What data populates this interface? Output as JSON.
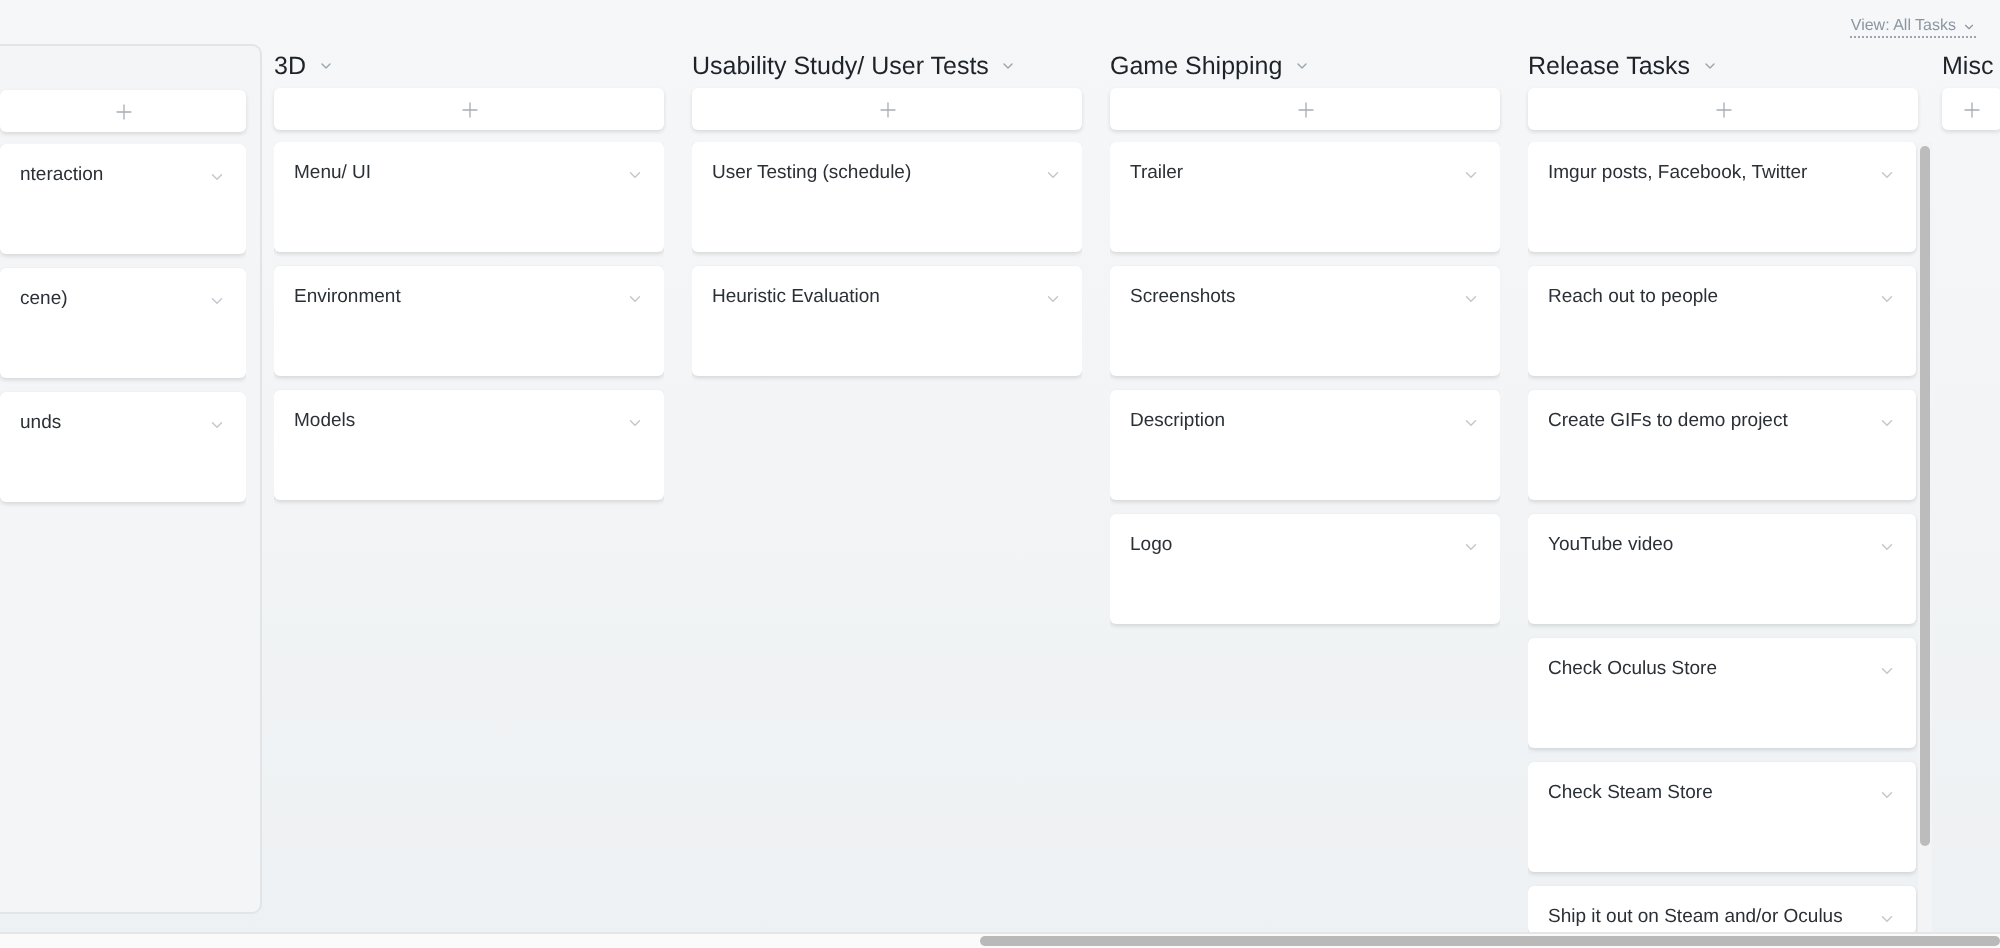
{
  "view_menu": {
    "label": "View: All Tasks"
  },
  "columns": [
    {
      "kind": "partial",
      "cards": [
        {
          "title": "nteraction"
        },
        {
          "title": "cene)"
        },
        {
          "title": "unds"
        }
      ]
    },
    {
      "kind": "full",
      "title": "3D",
      "cards": [
        {
          "title": "Menu/ UI"
        },
        {
          "title": "Environment"
        },
        {
          "title": "Models"
        }
      ]
    },
    {
      "kind": "full",
      "title": "Usability Study/ User Tests",
      "cards": [
        {
          "title": "User Testing (schedule)"
        },
        {
          "title": "Heuristic Evaluation"
        }
      ]
    },
    {
      "kind": "full",
      "title": "Game Shipping",
      "cards": [
        {
          "title": "Trailer"
        },
        {
          "title": "Screenshots"
        },
        {
          "title": "Description"
        },
        {
          "title": "Logo"
        }
      ]
    },
    {
      "kind": "scrolling",
      "title": "Release Tasks",
      "cards": [
        {
          "title": "Imgur posts, Facebook, Twitter"
        },
        {
          "title": "Reach out to people"
        },
        {
          "title": "Create GIFs to demo project"
        },
        {
          "title": "YouTube video"
        },
        {
          "title": "Check Oculus Store"
        },
        {
          "title": "Check Steam Store"
        },
        {
          "title": "Ship it out on Steam and/or Oculus"
        }
      ]
    },
    {
      "kind": "cut",
      "title": "Misc"
    }
  ]
}
